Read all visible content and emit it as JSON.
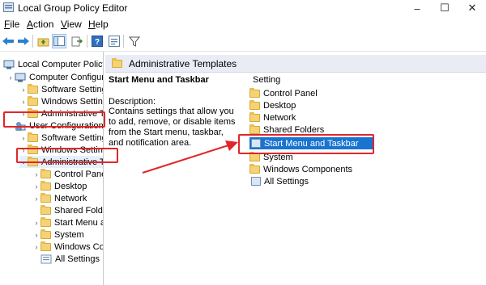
{
  "window": {
    "title": "Local Group Policy Editor",
    "controls": [
      "–",
      "☐",
      "✕"
    ]
  },
  "menu": [
    "File",
    "Action",
    "View",
    "Help"
  ],
  "tree": {
    "items": [
      {
        "label": "Local Computer Policy",
        "arrow": "",
        "indent": 0,
        "icon": "computer"
      },
      {
        "label": "Computer Configura",
        "arrow": "›",
        "indent": 1,
        "icon": "computer-config"
      },
      {
        "label": "Software Settings",
        "arrow": "›",
        "indent": 2,
        "icon": "folder"
      },
      {
        "label": "Windows Setting",
        "arrow": "›",
        "indent": 2,
        "icon": "folder"
      },
      {
        "label": "Administrative Te",
        "arrow": "›",
        "indent": 2,
        "icon": "folder"
      },
      {
        "label": "User Configuration",
        "arrow": "⌄",
        "indent": 1,
        "icon": "user-config"
      },
      {
        "label": "Software Settings",
        "arrow": "›",
        "indent": 2,
        "icon": "folder"
      },
      {
        "label": "Windows Setting",
        "arrow": "›",
        "indent": 2,
        "icon": "folder"
      },
      {
        "label": "Administrative Te",
        "arrow": "⌄",
        "indent": 2,
        "icon": "folder"
      },
      {
        "label": "Control Panel",
        "arrow": "›",
        "indent": 3,
        "icon": "folder"
      },
      {
        "label": "Desktop",
        "arrow": "›",
        "indent": 3,
        "icon": "folder"
      },
      {
        "label": "Network",
        "arrow": "›",
        "indent": 3,
        "icon": "folder"
      },
      {
        "label": "Shared Folder",
        "arrow": "",
        "indent": 3,
        "icon": "folder"
      },
      {
        "label": "Start Menu ar",
        "arrow": "›",
        "indent": 3,
        "icon": "folder"
      },
      {
        "label": "System",
        "arrow": "›",
        "indent": 3,
        "icon": "folder"
      },
      {
        "label": "Windows Cor",
        "arrow": "›",
        "indent": 3,
        "icon": "folder"
      },
      {
        "label": "All Settings",
        "arrow": "",
        "indent": 3,
        "icon": "settings"
      }
    ]
  },
  "right": {
    "header": "Administrative Templates",
    "desc_title": "Start Menu and Taskbar",
    "desc_label": "Description:",
    "desc_text": "Contains settings that allow you to add, remove, or disable items from the Start menu, taskbar, and notification area.",
    "column": "Setting",
    "items": [
      {
        "label": "Control Panel",
        "icon": "folder",
        "selected": false
      },
      {
        "label": "Desktop",
        "icon": "folder",
        "selected": false
      },
      {
        "label": "Network",
        "icon": "folder",
        "selected": false
      },
      {
        "label": "Shared Folders",
        "icon": "folder",
        "selected": false
      },
      {
        "label": "Start Menu and Taskbar",
        "icon": "policy",
        "selected": true
      },
      {
        "label": "System",
        "icon": "folder",
        "selected": false
      },
      {
        "label": "Windows Components",
        "icon": "folder",
        "selected": false
      },
      {
        "label": "All Settings",
        "icon": "settings",
        "selected": false
      }
    ]
  },
  "colors": {
    "selection": "#1874d0",
    "annotation": "#e0262a",
    "header": "#e9ecf5"
  }
}
